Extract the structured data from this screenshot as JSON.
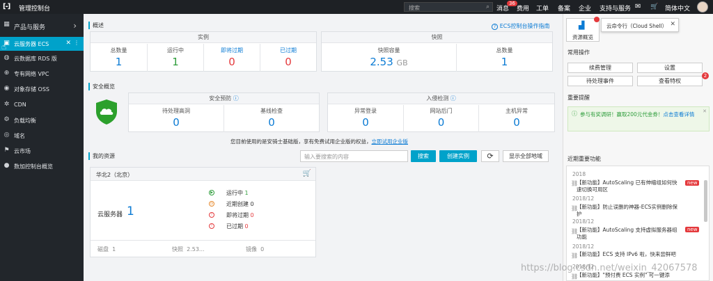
{
  "topbar": {
    "logo": "[-]",
    "title": "管理控制台",
    "search_placeholder": "搜索",
    "nav": [
      "消息",
      "费用",
      "工单",
      "备案",
      "企业",
      "支持与服务",
      "简体中文"
    ],
    "message_badge": "36"
  },
  "sidebar": {
    "items": [
      {
        "label": "产品与服务"
      },
      {
        "label": "云服务器 ECS"
      },
      {
        "label": "云数据库 RDS 版"
      },
      {
        "label": "专有网络 VPC"
      },
      {
        "label": "对象存储 OSS"
      },
      {
        "label": "CDN"
      },
      {
        "label": "负载均衡"
      },
      {
        "label": "域名"
      },
      {
        "label": "云市场"
      },
      {
        "label": "数加控制台概览"
      }
    ]
  },
  "overview": {
    "title": "概述",
    "guide_link": "ECS控制台操作指南",
    "instances_header": "实例",
    "snapshot_header": "快照",
    "instances": [
      {
        "label": "总数量",
        "value": "1",
        "color": "#0b7bd4"
      },
      {
        "label": "运行中",
        "value": "1",
        "color": "#2e9d3b"
      },
      {
        "label": "即将过期",
        "value": "0",
        "color": "#e4393c"
      },
      {
        "label": "已过期",
        "value": "0",
        "color": "#e4393c"
      }
    ],
    "snapshot_capacity_label": "快照容量",
    "snapshot_capacity_value": "2.53",
    "snapshot_capacity_unit": "GB",
    "snapshot_total_label": "总数量",
    "snapshot_total_value": "1"
  },
  "security": {
    "title": "安全概览",
    "defense_header": "安全预防",
    "intrusion_header": "入侵检测",
    "defense": [
      {
        "label": "待处理高洞",
        "value": "0"
      },
      {
        "label": "基线检查",
        "value": "0"
      }
    ],
    "intrusion": [
      {
        "label": "异常登录",
        "value": "0"
      },
      {
        "label": "网站后门",
        "value": "0"
      },
      {
        "label": "主机异常",
        "value": "0"
      }
    ],
    "note": "您目前使用的是安骑士基础版，享有免费试用企业版的权益，",
    "note_link": "立即试用企业版"
  },
  "resources": {
    "title": "我的资源",
    "search_placeholder": "输入要搜索的内容",
    "search_button": "搜索",
    "create_button": "创建实例",
    "refresh_icon": "refresh-icon",
    "all_regions_button": "显示全部地域",
    "region": "华北2（北京）",
    "server_label": "云服务器",
    "server_count": "1",
    "statuses": [
      {
        "label": "运行中",
        "value": "1"
      },
      {
        "label": "近期创建",
        "value": "0"
      },
      {
        "label": "即将过期",
        "value": "0"
      },
      {
        "label": "已过期",
        "value": "0"
      }
    ],
    "footer": [
      {
        "label": "磁盘",
        "value": "1"
      },
      {
        "label": "快照",
        "value": "2.53..."
      },
      {
        "label": "镜像",
        "value": "0"
      }
    ]
  },
  "rightpanel": {
    "resource_overview": "资源概览",
    "cloud_shell_tip": "云命令行（Cloud Shell）",
    "common_ops_title": "常用操作",
    "ops": [
      "续费管理",
      "设置",
      "待处理事件",
      "查看特权"
    ],
    "ops_badge": "2",
    "notice_title": "重要提醒",
    "notice_text": "参与有奖调研！赢取200元代金券！",
    "notice_link": "点击查看详情",
    "recent_title": "近期重要功能",
    "news": [
      {
        "date": "2018",
        "text": "【新功能】AutoScaling 已有伸缩组如何快速切换可用区",
        "new": true
      },
      {
        "date": "2018/12",
        "text": "【新功能】防止误删的神器-ECS实例删除保护",
        "new": false
      },
      {
        "date": "2018/12",
        "text": "【新功能】AutoScaling 支持虚拟服务器组功能",
        "new": true
      },
      {
        "date": "2018/12",
        "text": "【新功能】ECS 支持 IPv6 啦，快来尝鲜吧",
        "new": false
      },
      {
        "date": "2018/12",
        "text": "【新功能】\"预付费 ECS 实例\" 可一键添",
        "new": false
      }
    ],
    "new_tag": "new"
  },
  "watermark": "https://blog.csdn.net/weixin_42067578"
}
